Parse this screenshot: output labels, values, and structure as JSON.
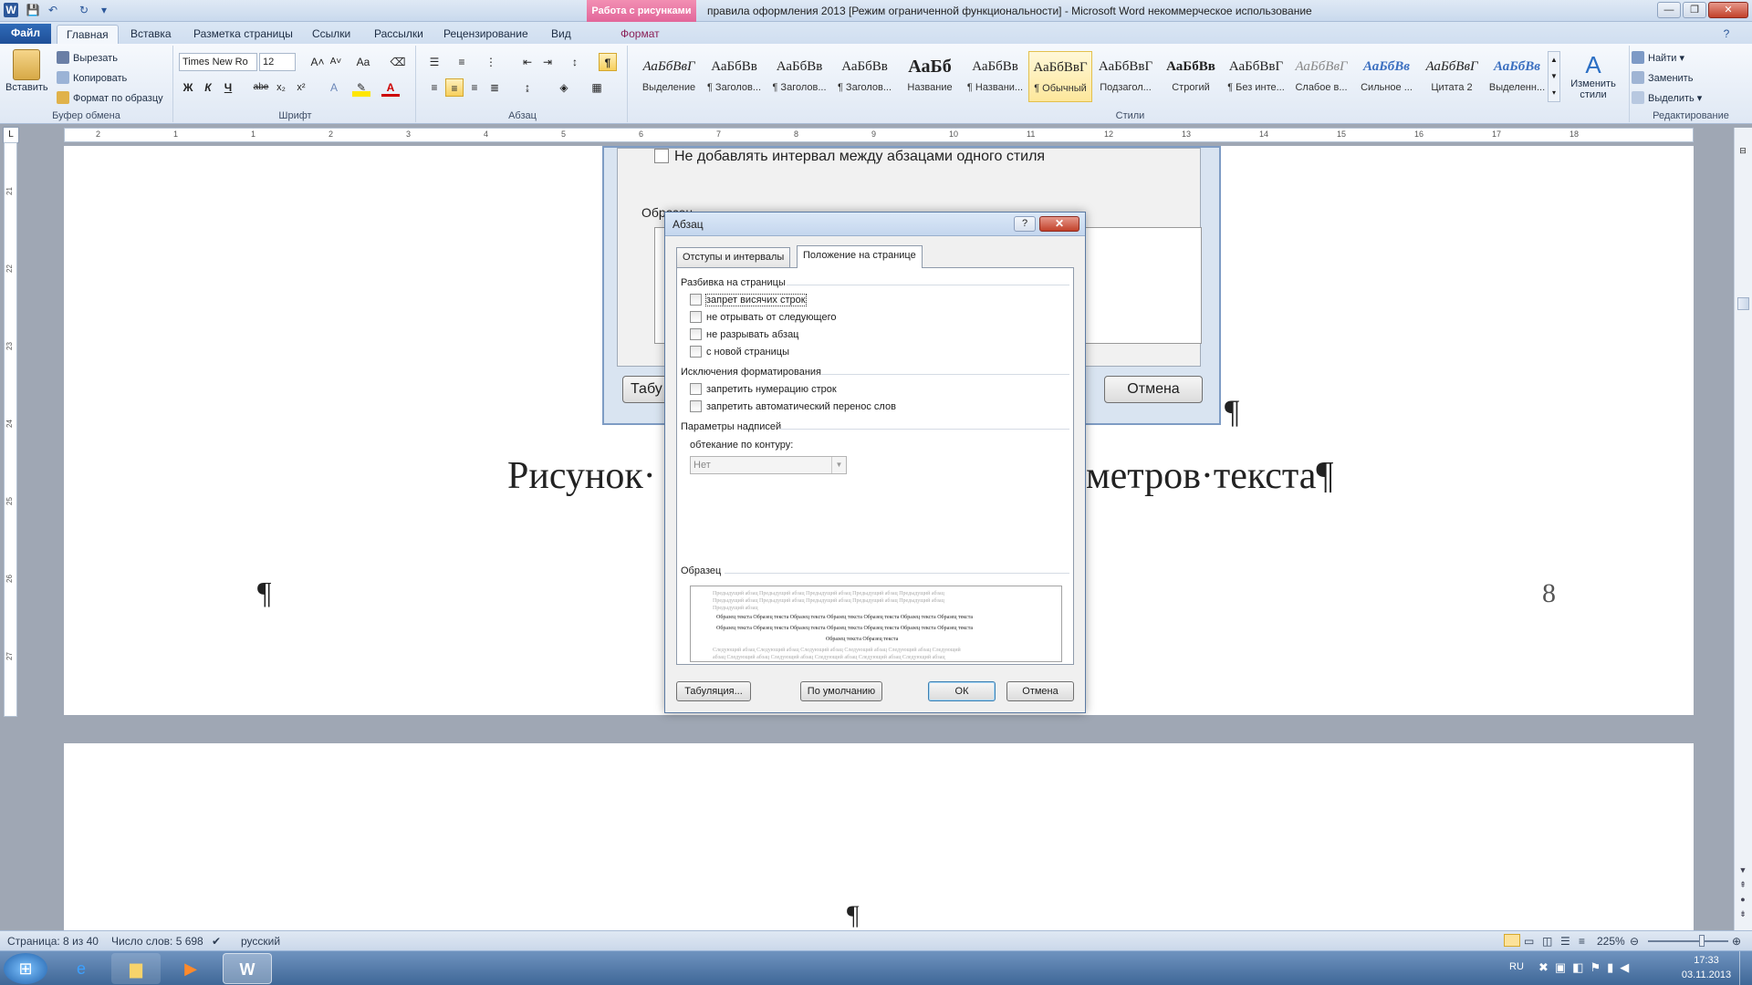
{
  "titlebar": {
    "context_tab": "Работа с рисунками",
    "title": "правила оформления 2013 [Режим ограниченной функциональности]  -  Microsoft Word некоммерческое использование"
  },
  "tabs": {
    "file": "Файл",
    "home": "Главная",
    "insert": "Вставка",
    "layout": "Разметка страницы",
    "references": "Ссылки",
    "mailings": "Рассылки",
    "review": "Рецензирование",
    "view": "Вид",
    "format": "Формат"
  },
  "clipboard": {
    "paste": "Вставить",
    "cut": "Вырезать",
    "copy": "Копировать",
    "format_painter": "Формат по образцу",
    "label": "Буфер обмена"
  },
  "font": {
    "name": "Times New Ro",
    "size": "12",
    "bold": "Ж",
    "italic": "К",
    "underline": "Ч",
    "strike": "abe",
    "sub": "x₂",
    "sup": "x²",
    "label": "Шрифт"
  },
  "paragraph": {
    "label": "Абзац",
    "pilcrow": "¶"
  },
  "styles": {
    "label": "Стили",
    "change": "Изменить стили",
    "items": [
      {
        "sample": "АаБбВвГ",
        "name": "Выделение"
      },
      {
        "sample": "АаБбВв",
        "name": "¶ Заголов..."
      },
      {
        "sample": "АаБбВв",
        "name": "¶ Заголов..."
      },
      {
        "sample": "АаБбВв",
        "name": "¶ Заголов..."
      },
      {
        "sample": "АаБб",
        "name": "Название"
      },
      {
        "sample": "АаБбВв",
        "name": "¶ Названи..."
      },
      {
        "sample": "АаБбВвГ",
        "name": "¶ Обычный"
      },
      {
        "sample": "АаБбВвГ",
        "name": "Подзагол..."
      },
      {
        "sample": "АаБбВв",
        "name": "Строгий"
      },
      {
        "sample": "АаБбВвГ",
        "name": "¶ Без инте..."
      },
      {
        "sample": "АаБбВвГ",
        "name": "Слабое в..."
      },
      {
        "sample": "АаБбВв",
        "name": "Сильное ..."
      },
      {
        "sample": "АаБбВвГ",
        "name": "Цитата 2"
      },
      {
        "sample": "АаБбВв",
        "name": "Выделенн..."
      }
    ]
  },
  "editing": {
    "label": "Редактирование",
    "find": "Найти",
    "replace": "Заменить",
    "select": "Выделить"
  },
  "ruler": {
    "ticks": [
      "2",
      "1",
      "1",
      "2",
      "3",
      "4",
      "5",
      "6",
      "7",
      "8",
      "9",
      "10",
      "11",
      "12",
      "13",
      "14",
      "15",
      "16",
      "17",
      "18"
    ],
    "vticks": [
      "21",
      "22",
      "23",
      "24",
      "25",
      "26",
      "27"
    ]
  },
  "document": {
    "embedded_checkbox": "Не добавлять интервал между абзацами одного стиля",
    "embedded_sample": "Образец",
    "embedded_tab_btn": "Табу",
    "embedded_cancel": "Отмена",
    "caption_left": "Рисунок· ",
    "caption_right": "метров·текста¶",
    "pilcrow": "¶",
    "page_number": "8",
    "page2_pilcrow": "¶"
  },
  "dialog": {
    "title": "Абзац",
    "help": "?",
    "close": "✕",
    "tab_indents": "Отступы и интервалы",
    "tab_position": "Положение на странице",
    "section_pagination": "Разбивка на страницы",
    "cb_widow": "запрет висячих строк",
    "cb_keep_next": "не отрывать от следующего",
    "cb_keep_lines": "не разрывать абзац",
    "cb_page_break": "с новой страницы",
    "section_exceptions": "Исключения форматирования",
    "cb_suppress_numbers": "запретить нумерацию строк",
    "cb_no_hyphen": "запретить автоматический перенос слов",
    "section_textbox": "Параметры надписей",
    "wrap_label": "обтекание по контуру:",
    "wrap_value": "Нет",
    "section_preview": "Образец",
    "preview_prev": "Предыдущий абзац Предыдущий абзац Предыдущий абзац Предыдущий абзац Предыдущий абзац",
    "preview_prev2": "Предыдущий абзац Предыдущий абзац Предыдущий абзац Предыдущий абзац Предыдущий абзац",
    "preview_prev3": "Предыдущий абзац",
    "preview_sample": "Образец текста Образец текста Образец текста Образец текста Образец текста Образец текста Образец текста",
    "preview_sample2": "Образец текста Образец текста Образец текста Образец текста Образец текста Образец текста Образец текста",
    "preview_sample3": "Образец текста Образец текста",
    "preview_next": "Следующий абзац Следующий абзац Следующий абзац Следующий абзац Следующий абзац Следующий",
    "preview_next2": "абзац Следующий абзац Следующий абзац Следующий абзац Следующий абзац Следующий абзац",
    "btn_tabs": "Табуляция...",
    "btn_default": "По умолчанию",
    "btn_ok": "ОК",
    "btn_cancel": "Отмена"
  },
  "status": {
    "page": "Страница: 8 из 40",
    "words": "Число слов: 5 698",
    "lang": "русский",
    "zoom": "225%"
  },
  "taskbar": {
    "lang": "RU",
    "time": "17:33",
    "date": "03.11.2013"
  }
}
